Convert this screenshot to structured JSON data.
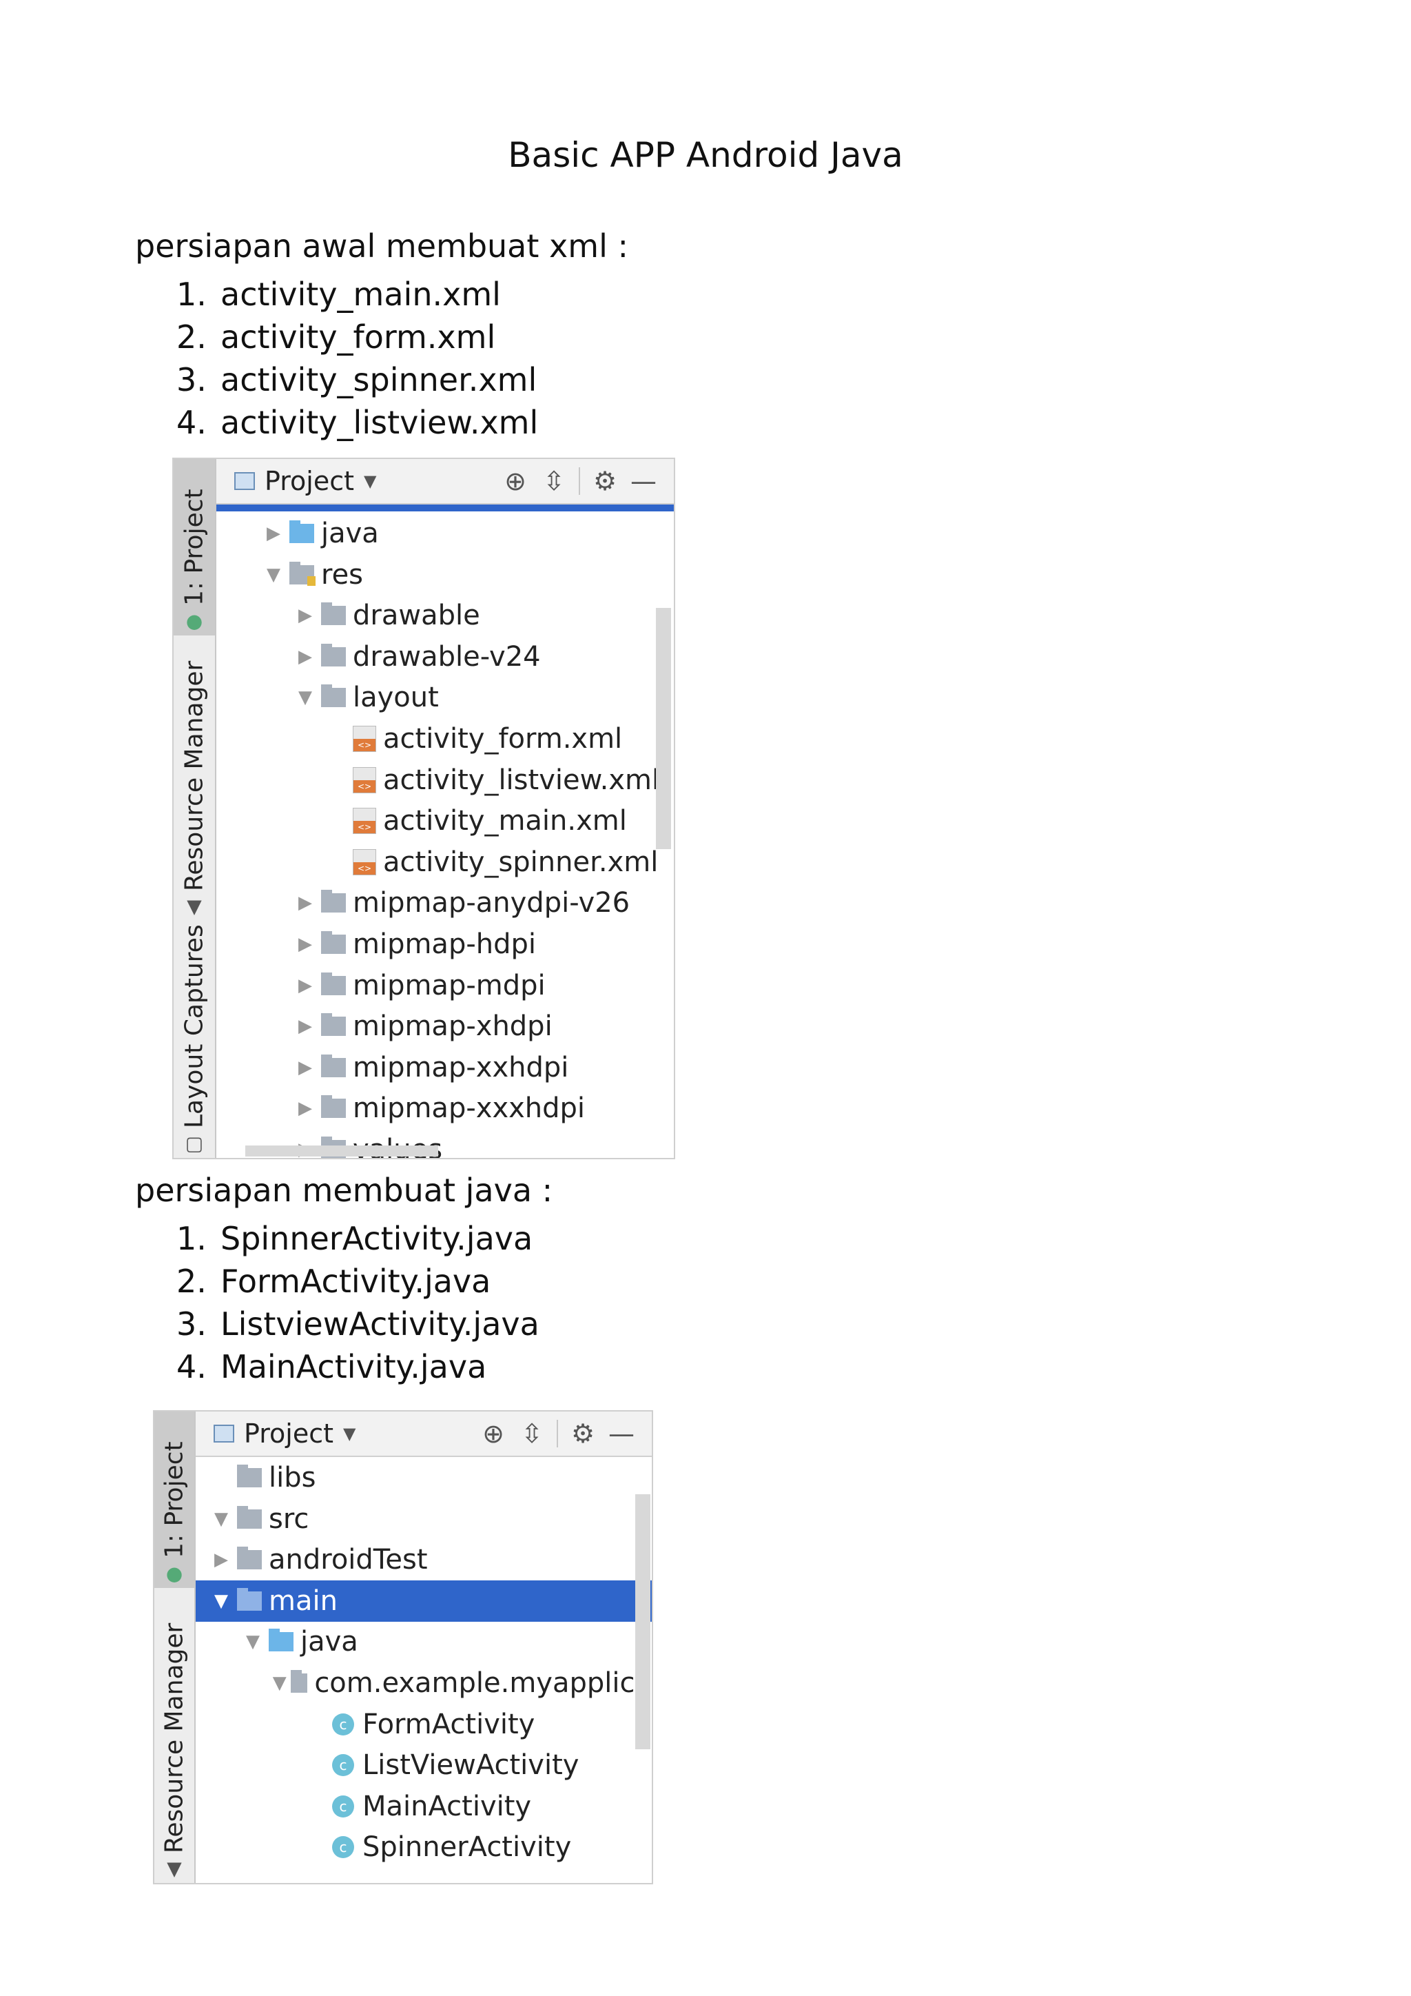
{
  "title": "Basic APP Android Java",
  "section1": {
    "heading": "persiapan awal membuat xml :",
    "items": [
      {
        "num": "1.",
        "text": "activity_main.xml"
      },
      {
        "num": "2.",
        "text": "activity_form.xml"
      },
      {
        "num": "3.",
        "text": "activity_spinner.xml"
      },
      {
        "num": "4.",
        "text": "activity_listview.xml"
      }
    ]
  },
  "panel1": {
    "tabs": {
      "project": "1: Project",
      "resource_manager": "Resource Manager",
      "layout_captures": "Layout Captures"
    },
    "header_label": "Project",
    "tree": [
      {
        "label": "java",
        "arrow": "▶",
        "icon": "folder-blue"
      },
      {
        "label": "res",
        "arrow": "▼",
        "icon": "folder-res"
      },
      {
        "label": "drawable",
        "arrow": "▶",
        "icon": "folder"
      },
      {
        "label": "drawable-v24",
        "arrow": "▶",
        "icon": "folder"
      },
      {
        "label": "layout",
        "arrow": "▼",
        "icon": "folder"
      },
      {
        "label": "activity_form.xml",
        "arrow": "",
        "icon": "xml"
      },
      {
        "label": "activity_listview.xml",
        "arrow": "",
        "icon": "xml"
      },
      {
        "label": "activity_main.xml",
        "arrow": "",
        "icon": "xml"
      },
      {
        "label": "activity_spinner.xml",
        "arrow": "",
        "icon": "xml"
      },
      {
        "label": "mipmap-anydpi-v26",
        "arrow": "▶",
        "icon": "folder"
      },
      {
        "label": "mipmap-hdpi",
        "arrow": "▶",
        "icon": "folder"
      },
      {
        "label": "mipmap-mdpi",
        "arrow": "▶",
        "icon": "folder"
      },
      {
        "label": "mipmap-xhdpi",
        "arrow": "▶",
        "icon": "folder"
      },
      {
        "label": "mipmap-xxhdpi",
        "arrow": "▶",
        "icon": "folder"
      },
      {
        "label": "mipmap-xxxhdpi",
        "arrow": "▶",
        "icon": "folder"
      },
      {
        "label": "values",
        "arrow": "▶",
        "icon": "folder"
      }
    ]
  },
  "section2": {
    "heading": "persiapan membuat java :",
    "items": [
      {
        "num": "1.",
        "text": "SpinnerActivity.java"
      },
      {
        "num": "2.",
        "text": "FormActivity.java"
      },
      {
        "num": "3.",
        "text": "ListviewActivity.java"
      },
      {
        "num": "4.",
        "text": "MainActivity.java"
      }
    ]
  },
  "panel2": {
    "tabs": {
      "project": "1: Project",
      "resource_manager": "Resource Manager"
    },
    "header_label": "Project",
    "tree": [
      {
        "label": "libs",
        "arrow": "",
        "icon": "folder",
        "selected": false
      },
      {
        "label": "src",
        "arrow": "▼",
        "icon": "folder",
        "selected": false
      },
      {
        "label": "androidTest",
        "arrow": "▶",
        "icon": "folder",
        "selected": false
      },
      {
        "label": "main",
        "arrow": "▼",
        "icon": "folder",
        "selected": true
      },
      {
        "label": "java",
        "arrow": "▼",
        "icon": "folder-blue",
        "selected": false
      },
      {
        "label": "com.example.myapplica",
        "arrow": "▼",
        "icon": "folder",
        "selected": false
      },
      {
        "label": "FormActivity",
        "arrow": "",
        "icon": "class",
        "selected": false
      },
      {
        "label": "ListViewActivity",
        "arrow": "",
        "icon": "class",
        "selected": false
      },
      {
        "label": "MainActivity",
        "arrow": "",
        "icon": "class",
        "selected": false
      },
      {
        "label": "SpinnerActivity",
        "arrow": "",
        "icon": "class",
        "selected": false
      }
    ]
  },
  "colors": {
    "selection": "#2f65ca",
    "folder": "#a9b2bd",
    "source_folder": "#6cb5e8",
    "xml_badge": "#e07b3a",
    "class_icon": "#6cc0d8"
  }
}
